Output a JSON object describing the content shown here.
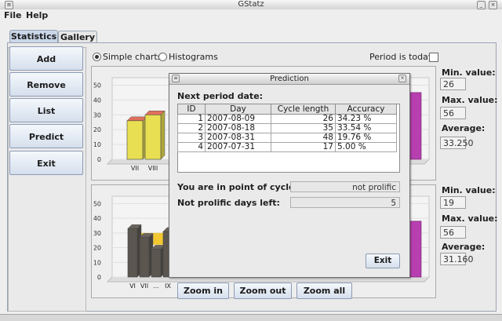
{
  "window": {
    "title": "GStatz"
  },
  "menubar": {
    "items": [
      "File",
      "Help"
    ]
  },
  "tabs": [
    {
      "label": "Statistics"
    },
    {
      "label": "Gallery"
    }
  ],
  "sidebar": {
    "buttons": [
      "Add",
      "Remove",
      "List",
      "Predict",
      "Exit"
    ]
  },
  "chart_mode": {
    "simple": "Simple charts",
    "histograms": "Histograms",
    "selected": "Simple charts"
  },
  "period_is_today": {
    "label": "Period is today",
    "checked": false
  },
  "stats_top": {
    "min_label": "Min. value:",
    "min_value": "26",
    "max_label": "Max. value:",
    "max_value": "56",
    "avg_label": "Average:",
    "avg_value": "33.250"
  },
  "stats_bottom": {
    "min_label": "Min. value:",
    "min_value": "19",
    "max_label": "Max. value:",
    "max_value": "56",
    "avg_label": "Average:",
    "avg_value": "31.160"
  },
  "zoom": {
    "in": "Zoom in",
    "out": "Zoom out",
    "all": "Zoom all"
  },
  "dialog": {
    "title": "Prediction",
    "next_period_label": "Next period date:",
    "columns": [
      "ID",
      "Day",
      "Cycle length",
      "Accuracy"
    ],
    "rows": [
      [
        "1",
        "2007-08-09",
        "26",
        "34.23 %"
      ],
      [
        "2",
        "2007-08-18",
        "35",
        "33.54 %"
      ],
      [
        "3",
        "2007-08-31",
        "48",
        "19.76 %"
      ],
      [
        "4",
        "2007-07-31",
        "17",
        "5.00 %"
      ]
    ],
    "cycle_point_label": "You are in point of cycle:",
    "cycle_point_value": "not prolific",
    "days_left_label": "Not prolific days left:",
    "days_left_value": "5",
    "exit_label": "Exit"
  },
  "chart_data": [
    {
      "type": "bar",
      "categories": [
        "VII",
        "VIII"
      ],
      "values": [
        26,
        30
      ],
      "yticks": [
        0,
        10,
        20,
        30,
        40,
        50
      ],
      "ylim": [
        0,
        55
      ],
      "colors": [
        "#e8df52",
        "#e8df52"
      ],
      "xlabel": "",
      "ylabel": ""
    },
    {
      "type": "bar",
      "categories": [
        "VI",
        "VII",
        "...",
        "IX"
      ],
      "values": [
        33,
        27,
        19,
        31
      ],
      "yticks": [
        0,
        10,
        20,
        30,
        40,
        50
      ],
      "ylim": [
        0,
        55
      ],
      "colors": [
        "#5b5650",
        "#5b5650",
        "#5b5650",
        "#5b5650"
      ],
      "xlabel": "",
      "ylabel": ""
    }
  ],
  "colors": {
    "accent": "#c9d6e8",
    "magenta_bar": "#b73fb0",
    "yellow_band": "#f2c21b"
  }
}
